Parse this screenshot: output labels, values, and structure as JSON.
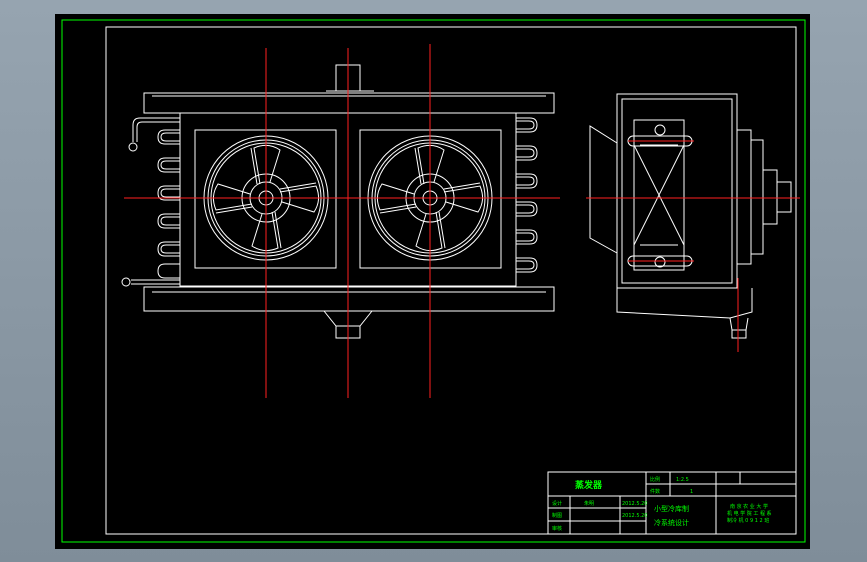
{
  "colors": {
    "background": "#000000",
    "frame": "#00ff00",
    "drawing_lines": "#ffffff",
    "center_lines": "#ff0000",
    "titleblock_lines": "#ffffff",
    "titleblock_text": "#00ff00"
  },
  "title_block": {
    "part_name": "蒸发器",
    "scale_label": "比例",
    "scale_value": "1:2.5",
    "quantity_label": "件数",
    "quantity_value": "1",
    "designer_label": "设计",
    "designer_name": "朱明",
    "designer_date": "2012.5.20",
    "drafter_label": "制图",
    "drafter_date": "2012.5.20",
    "checker_label": "审核",
    "project_line1": "小型冷库制",
    "project_line2": "冷系统设计",
    "school_line1": "南 京 农 业 大 学",
    "school_line2": "机 电 学 院 工 程 系",
    "school_line3": "制冷 机 0 9 1 2 班"
  }
}
